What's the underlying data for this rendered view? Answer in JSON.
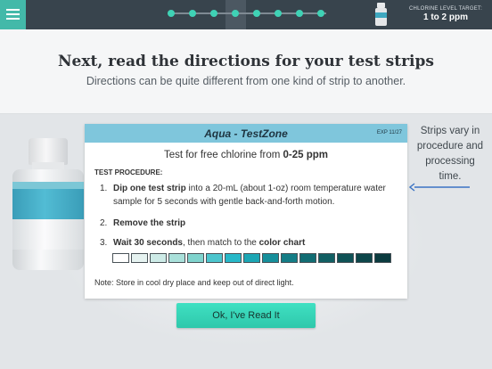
{
  "topbar": {
    "menu_icon": "hamburger-icon",
    "progress_steps": 8,
    "current_step": 4,
    "chlorine_label": "CHLORINE LEVEL TARGET:",
    "chlorine_value": "1 to 2 ppm",
    "bottle_icon": "test-strip-bottle-icon"
  },
  "header": {
    "title": "Next, read the directions for your test strips",
    "subtitle": "Directions can be quite different from one kind of strip to another."
  },
  "card": {
    "brand": "Aqua - TestZone",
    "exp": "EXP 11/27",
    "test_prefix": "Test for free chlorine from ",
    "test_range": "0-25 ppm",
    "procedure_heading": "TEST PROCEDURE:",
    "steps": [
      {
        "num": "1.",
        "bold": "Dip one test strip",
        "rest": " into a 20-mL (about 1-oz) room temperature water sample for 5 seconds with gentle back-and-forth motion."
      },
      {
        "num": "2.",
        "bold": "Remove the strip",
        "rest": ""
      },
      {
        "num": "3.",
        "bold": "Wait 30 seconds",
        "mid": ", then match to the ",
        "bold2": "color chart"
      }
    ],
    "color_chart": [
      "#ffffff",
      "#e6f3f1",
      "#cdebe7",
      "#a9e0da",
      "#7fd3cd",
      "#4cc5cd",
      "#27b8c8",
      "#1ca6b4",
      "#168f9b",
      "#147d86",
      "#126d73",
      "#115f63",
      "#0f5256",
      "#0d464a",
      "#0b3b3f"
    ],
    "note": "Note: Store in cool dry place and keep out of direct light."
  },
  "side_note": "Strips vary in procedure and processing time.",
  "ok_button": "Ok, I've Read It",
  "colors": {
    "accent": "#3fd2b5",
    "topbar": "#38444d",
    "card_header": "#7fc6dc",
    "arrow": "#3b73c4"
  }
}
